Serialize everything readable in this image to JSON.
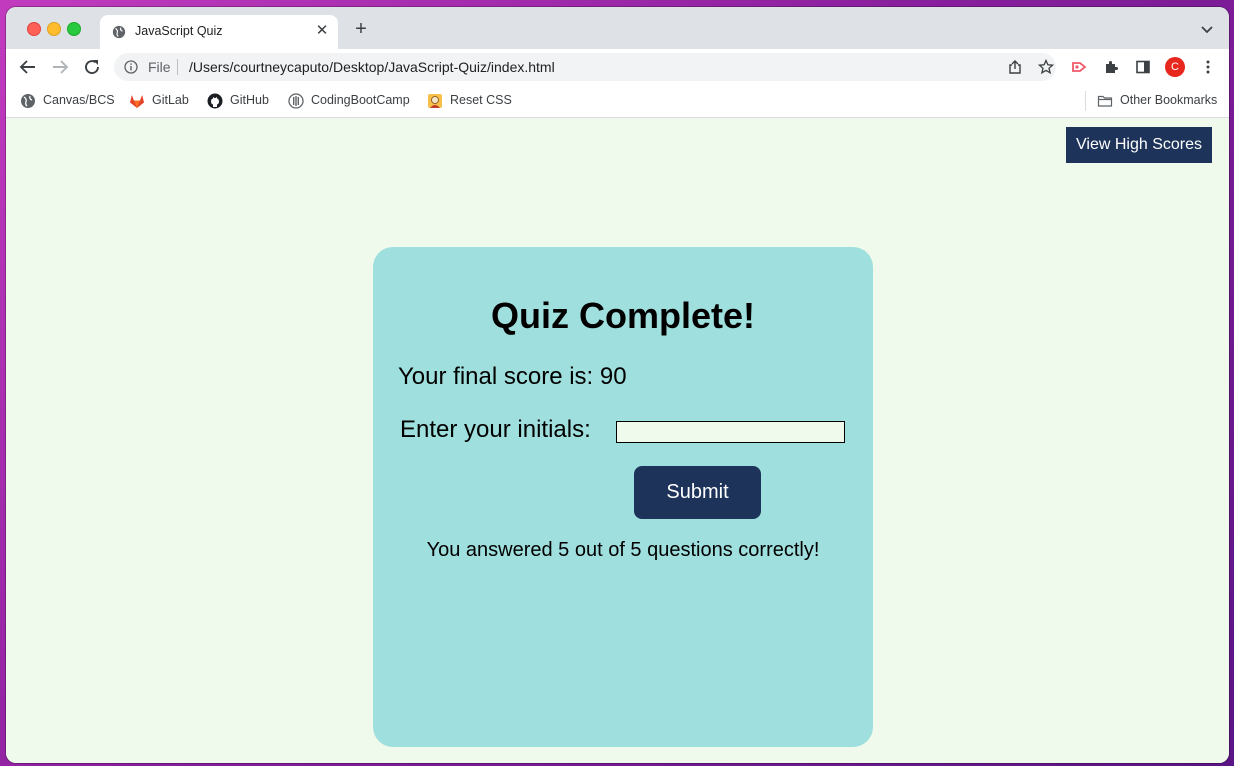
{
  "browser": {
    "tab_title": "JavaScript Quiz",
    "omnibox_scheme_label": "File",
    "url": "/Users/courtneycaputo/Desktop/JavaScript-Quiz/index.html",
    "profile_initial": "C",
    "bookmarks": [
      {
        "label": "Canvas/BCS",
        "icon": "globe-icon"
      },
      {
        "label": "GitLab",
        "icon": "gitlab-icon"
      },
      {
        "label": "GitHub",
        "icon": "github-icon"
      },
      {
        "label": "CodingBootCamp",
        "icon": "codingbootcamp-icon"
      },
      {
        "label": "Reset CSS",
        "icon": "reset-css-icon"
      }
    ],
    "other_bookmarks": "Other Bookmarks"
  },
  "header": {
    "high_scores_label": "View High Scores"
  },
  "quiz": {
    "title": "Quiz Complete!",
    "score_text": "Your final score is: 90",
    "initials_label": "Enter your initials:",
    "initials_value": "",
    "submit_label": "Submit",
    "result_text": "You answered 5 out of 5 questions correctly!"
  },
  "colors": {
    "page_background": "#f0faec",
    "card_background": "#9fdfdd",
    "button_background": "#1d3359"
  }
}
